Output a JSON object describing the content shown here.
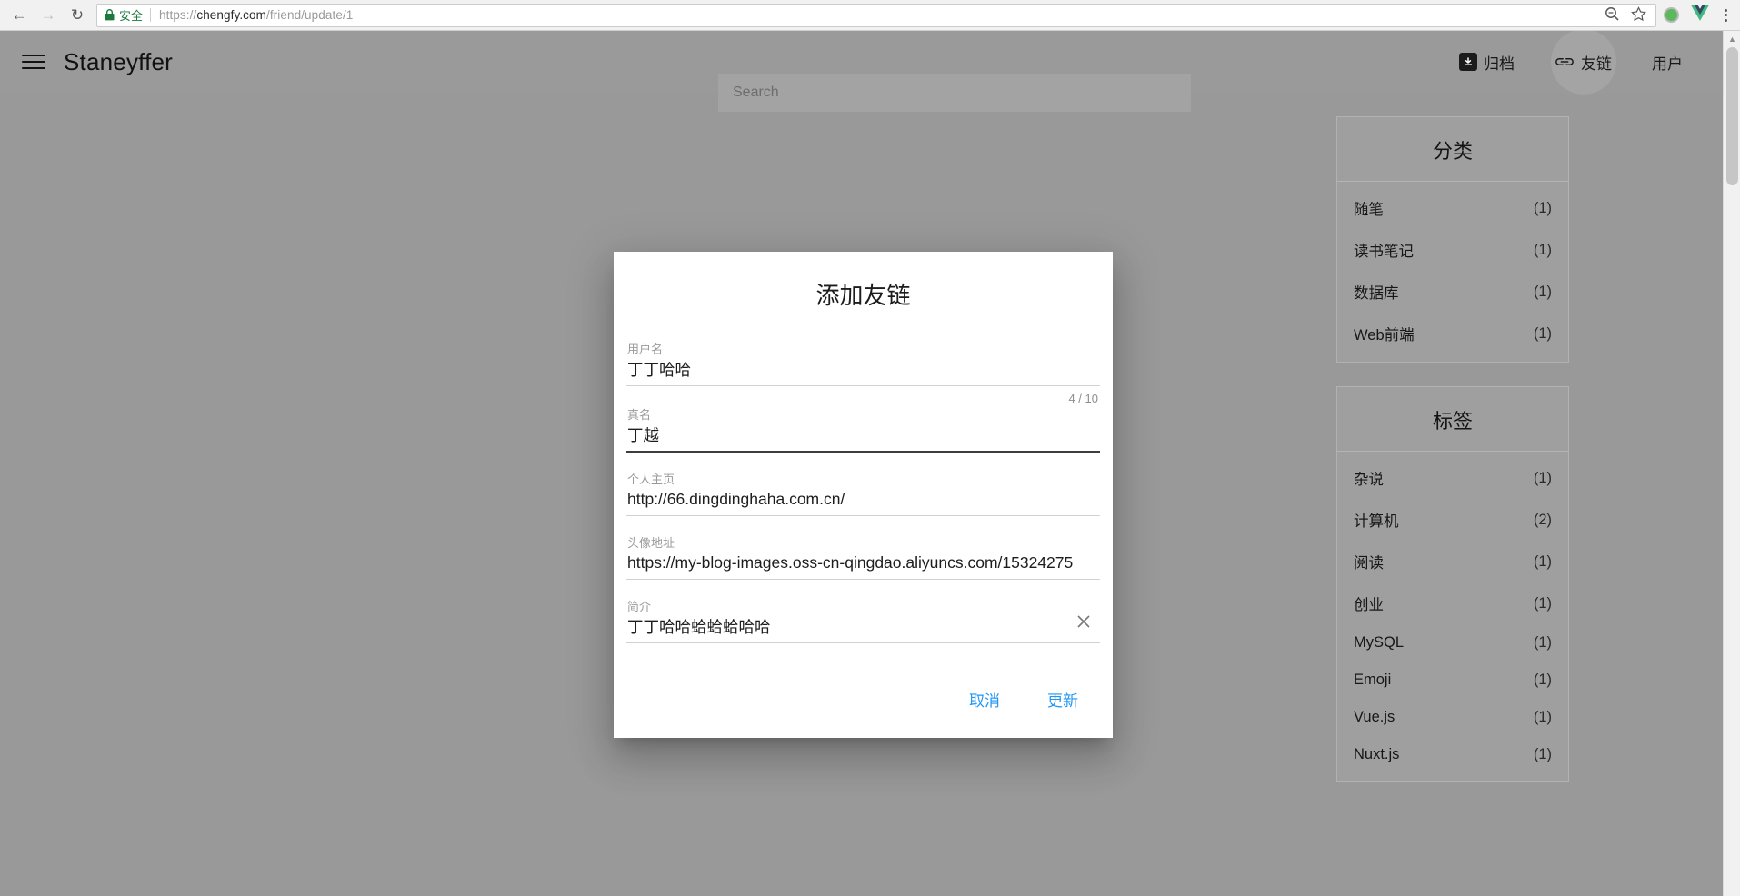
{
  "browser": {
    "back_icon": "back-arrow-icon",
    "forward_icon": "forward-arrow-icon",
    "reload_icon": "reload-icon",
    "secure_label": "安全",
    "url_scheme": "https://",
    "url_host": "chengfy.com",
    "url_path": "/friend/update/1",
    "zoom_icon": "zoom-icon",
    "bookmark_icon": "star-icon",
    "extension_icons": [
      "green-dot-extension-icon",
      "vue-devtools-icon"
    ],
    "menu_icon": "three-dot-menu-icon"
  },
  "header": {
    "menu_icon": "hamburger-menu-icon",
    "brand": "Staneyffer",
    "search_placeholder": "Search",
    "search_value": "",
    "nav": [
      {
        "label": "归档",
        "icon": "archive-icon",
        "active": false
      },
      {
        "label": "友链",
        "icon": "link-icon",
        "active": true
      },
      {
        "label": "用户",
        "icon": "",
        "active": false
      }
    ]
  },
  "sidebar": {
    "categories": {
      "title": "分类",
      "items": [
        {
          "label": "随笔",
          "count": "(1)"
        },
        {
          "label": "读书笔记",
          "count": "(1)"
        },
        {
          "label": "数据库",
          "count": "(1)"
        },
        {
          "label": "Web前端",
          "count": "(1)"
        }
      ]
    },
    "tags": {
      "title": "标签",
      "items": [
        {
          "label": "杂说",
          "count": "(1)"
        },
        {
          "label": "计算机",
          "count": "(2)"
        },
        {
          "label": "阅读",
          "count": "(1)"
        },
        {
          "label": "创业",
          "count": "(1)"
        },
        {
          "label": "MySQL",
          "count": "(1)"
        },
        {
          "label": "Emoji",
          "count": "(1)"
        },
        {
          "label": "Vue.js",
          "count": "(1)"
        },
        {
          "label": "Nuxt.js",
          "count": "(1)"
        }
      ]
    }
  },
  "dialog": {
    "title": "添加友链",
    "fields": [
      {
        "label": "用户名",
        "value": "丁丁哈哈",
        "placeholder": "",
        "counter": "4 / 10",
        "focused": false,
        "clearable": false
      },
      {
        "label": "真名",
        "value": "丁越",
        "placeholder": "",
        "counter": "",
        "focused": true,
        "clearable": false
      },
      {
        "label": "个人主页",
        "value": "http://66.dingdinghaha.com.cn/",
        "placeholder": "",
        "counter": "",
        "focused": false,
        "clearable": false
      },
      {
        "label": "头像地址",
        "value": "https://my-blog-images.oss-cn-qingdao.aliyuncs.com/15324275",
        "placeholder": "",
        "counter": "",
        "focused": false,
        "clearable": false
      },
      {
        "label": "简介",
        "value": "丁丁哈哈蛤蛤蛤哈哈",
        "placeholder": "",
        "counter": "",
        "focused": false,
        "clearable": true
      }
    ],
    "cancel_label": "取消",
    "submit_label": "更新",
    "clear_icon": "close-icon"
  },
  "scrollbar": {
    "up_arrow_icon": "chevron-up-icon"
  },
  "colors": {
    "accent": "#2196f3",
    "overlay": "#999999",
    "header_bg": "#9a9a9a",
    "secure_green": "#1a7a3c"
  }
}
